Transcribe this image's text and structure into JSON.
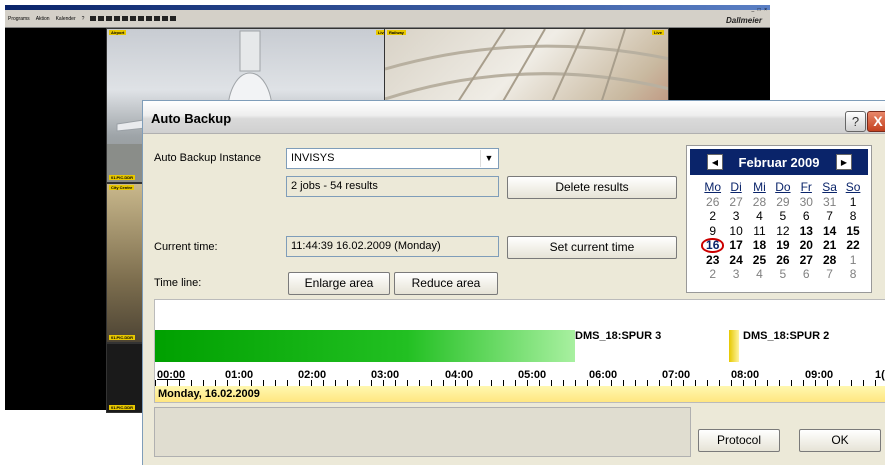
{
  "background_app": {
    "menu": [
      "Programs",
      "Aktion",
      "Kalender",
      "?"
    ],
    "brand": "Dallmeier",
    "window_buttons": "_ □ ×",
    "cameras": [
      {
        "label": "Airport",
        "status": "Live"
      },
      {
        "label": "Railway",
        "status": "Live"
      },
      {
        "label": "City Centre",
        "footer": "01.PIC.DDR"
      },
      {
        "label": "",
        "footer": "01.PIC.DDR"
      }
    ],
    "cam1_footer": "01.PIC.DDR"
  },
  "dialog": {
    "title": "Auto Backup",
    "help_label": "?",
    "close_label": "X",
    "instance_label": "Auto Backup Instance",
    "instance_value": "INVISYS",
    "jobs_summary": "2 jobs - 54 results",
    "delete_results": "Delete results",
    "current_time_label": "Current time:",
    "current_time_value": "11:44:39 16.02.2009 (Monday)",
    "set_current_time": "Set current time",
    "timeline_label": "Time line:",
    "enlarge_area": "Enlarge area",
    "reduce_area": "Reduce area",
    "protocol": "Protocol",
    "ok": "OK"
  },
  "calendar": {
    "month": "Februar 2009",
    "prev": "◀",
    "next": "▶",
    "weekdays": [
      "Mo",
      "Di",
      "Mi",
      "Do",
      "Fr",
      "Sa",
      "So"
    ],
    "weeks": [
      [
        "26",
        "27",
        "28",
        "29",
        "30",
        "31",
        "1"
      ],
      [
        "2",
        "3",
        "4",
        "5",
        "6",
        "7",
        "8"
      ],
      [
        "9",
        "10",
        "11",
        "12",
        "13",
        "14",
        "15"
      ],
      [
        "16",
        "17",
        "18",
        "19",
        "20",
        "21",
        "22"
      ],
      [
        "23",
        "24",
        "25",
        "26",
        "27",
        "28",
        "1"
      ],
      [
        "2",
        "3",
        "4",
        "5",
        "6",
        "7",
        "8"
      ]
    ],
    "selected": "16"
  },
  "timeline": {
    "tracks": [
      "DMS_18:SPUR 3",
      "DMS_18:SPUR 2"
    ],
    "hours": [
      "00:00",
      "01:00",
      "02:00",
      "03:00",
      "04:00",
      "05:00",
      "06:00",
      "07:00",
      "08:00",
      "09:00",
      "1("
    ],
    "date": "Monday, 16.02.2009"
  }
}
